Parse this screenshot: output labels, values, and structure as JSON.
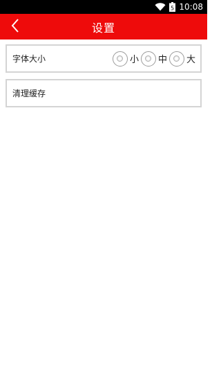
{
  "status_bar": {
    "time": "10:08",
    "icons": [
      "wifi-icon",
      "battery-icon"
    ],
    "battery_glyph": "5"
  },
  "header": {
    "title": "设置",
    "back_icon": "chevron-left-icon",
    "background_color": "#ee0b0b"
  },
  "settings": {
    "font_size": {
      "label": "字体大小",
      "options": [
        {
          "label": "小",
          "selected": false
        },
        {
          "label": "中",
          "selected": false
        },
        {
          "label": "大",
          "selected": false
        }
      ]
    },
    "clear_cache": {
      "label": "清理缓存"
    }
  }
}
